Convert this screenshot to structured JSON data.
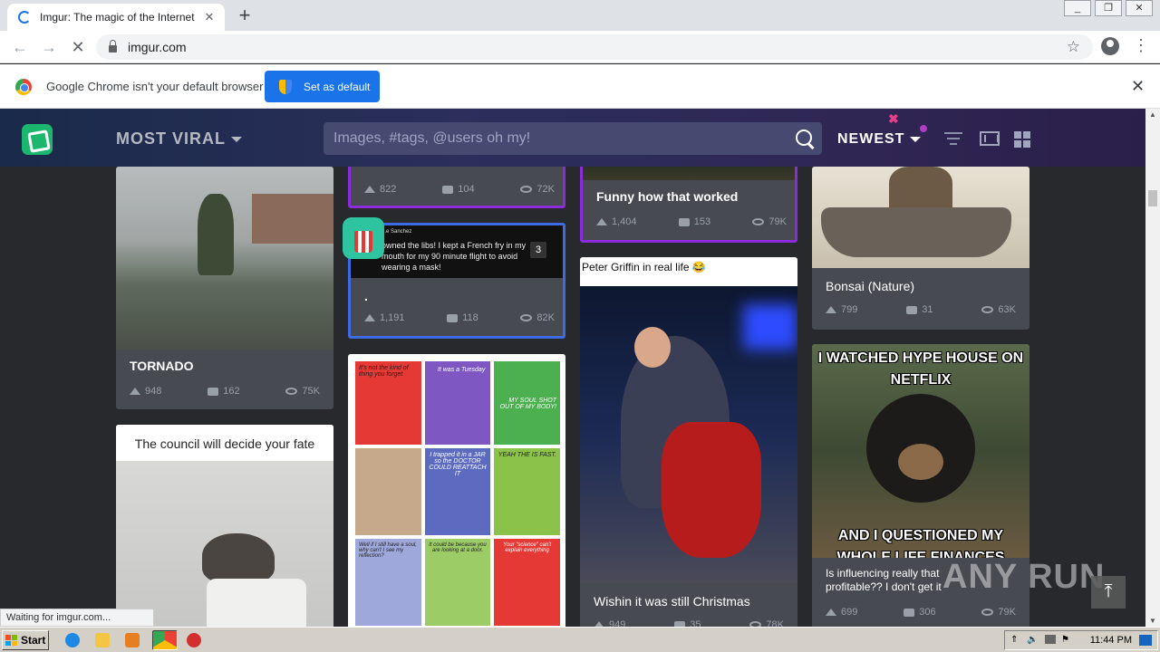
{
  "browser": {
    "tab_title": "Imgur: The magic of the Internet",
    "url": "imgur.com",
    "status": "Waiting for imgur.com..."
  },
  "infobar": {
    "message": "Google Chrome isn't your default browser",
    "button": "Set as default"
  },
  "header": {
    "section": "MOST VIRAL",
    "search_placeholder": "Images, #tags, @users oh my!",
    "sort": "NEWEST"
  },
  "cards": {
    "tornado": {
      "title": "TORNADO",
      "ups": "948",
      "comments": "162",
      "views": "75K"
    },
    "top_mid": {
      "ups": "822",
      "comments": "104",
      "views": "72K"
    },
    "tweet": {
      "title": ".",
      "ups": "1,191",
      "comments": "118",
      "views": "82K",
      "count": "3",
      "tweet_name": "...e Sanchez",
      "tweet_text": "owned the libs! I kept a French fry in my mouth for my 90 minute flight to avoid wearing a mask!"
    },
    "funny": {
      "title": "Funny how that worked",
      "ups": "1,404",
      "comments": "153",
      "views": "79K"
    },
    "bonsai": {
      "title": "Bonsai (Nature)",
      "ups": "799",
      "comments": "31",
      "views": "63K"
    },
    "council": {
      "caption": "The council will decide your fate"
    },
    "peter": {
      "caption": "Peter Griffin in real life 😂",
      "title": "Wishin it was still Christmas",
      "ups": "949",
      "comments": "35",
      "views": "78K"
    },
    "meme": {
      "top": "I WATCHED HYPE HOUSE ON NETFLIX",
      "bottom": "AND I QUESTIONED MY WHOLE LIFE FINANCES",
      "title": "Is influencing really that profitable?? I don't get it",
      "ups": "699",
      "comments": "306",
      "views": "79K"
    },
    "comic": {
      "p1": "It's not the kind of thing you forget",
      "p2": "It was a Tuesday",
      "p3": "MY SOUL SHOT OUT OF MY BODY!",
      "p4": "I trapped it in a JAR so the DOCTOR COULD REATTACH IT",
      "p5": "YEAH THE IS FAST.",
      "p6": "Well if I still have a soul, why can't I see my reflection?",
      "p7": "It could be because you are looking at a door.",
      "p8": "Your \"science\" can't explain everything"
    }
  },
  "taskbar": {
    "start": "Start",
    "clock": "11:44 PM"
  },
  "watermark": "ANY RUN",
  "colors": {
    "imgur_green": "#1bb76e",
    "purple_border": "#8c2bd9",
    "blue_border": "#3d6be3"
  }
}
